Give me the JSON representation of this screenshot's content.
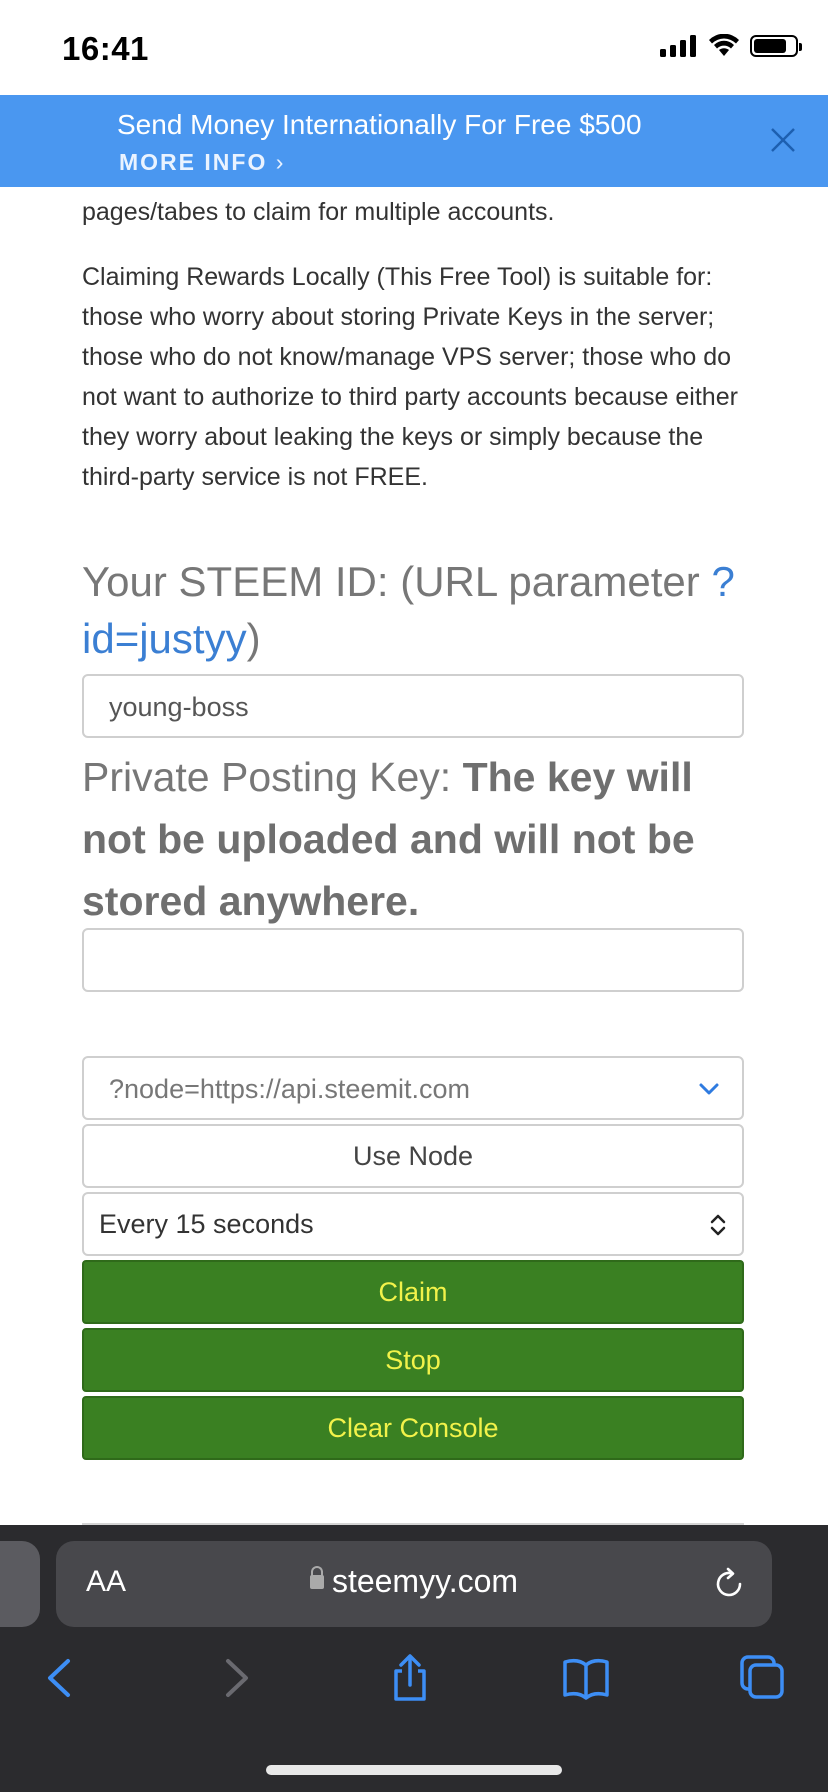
{
  "status_bar": {
    "time": "16:41"
  },
  "banner": {
    "title": "Send Money Internationally For Free $500",
    "more_info": "MORE INFO"
  },
  "content": {
    "partial_paragraph": "pages/tabes to claim for multiple accounts.",
    "paragraph": "Claiming Rewards Locally (This Free Tool) is suitable for: those who worry about storing Private Keys in the server; those who do not know/manage VPS server; those who do not want to authorize to third party accounts because either they worry about leaking the keys or simply because the third-party service is not FREE.",
    "steem_id_label": "Your STEEM ID: (URL parameter ",
    "steem_id_link": "?id=justyy",
    "steem_id_close": ")",
    "steem_id_value": "young-boss",
    "key_label_normal": "Private Posting Key: ",
    "key_label_bold": "The key will not be uploaded and will not be stored anywhere.",
    "key_value": "",
    "node_value": "?node=https://api.steemit.com",
    "use_node_label": "Use Node",
    "interval_value": "Every 15 seconds",
    "claim_label": "Claim",
    "stop_label": "Stop",
    "clear_console_label": "Clear Console"
  },
  "browser": {
    "aa_label": "AA",
    "url": "steemyy.com"
  },
  "colors": {
    "banner": "#4a97f0",
    "green_button": "#3a8022",
    "green_button_text": "#f2f24a",
    "link": "#3b7fd3",
    "safari_chrome": "#2b2b2e"
  }
}
